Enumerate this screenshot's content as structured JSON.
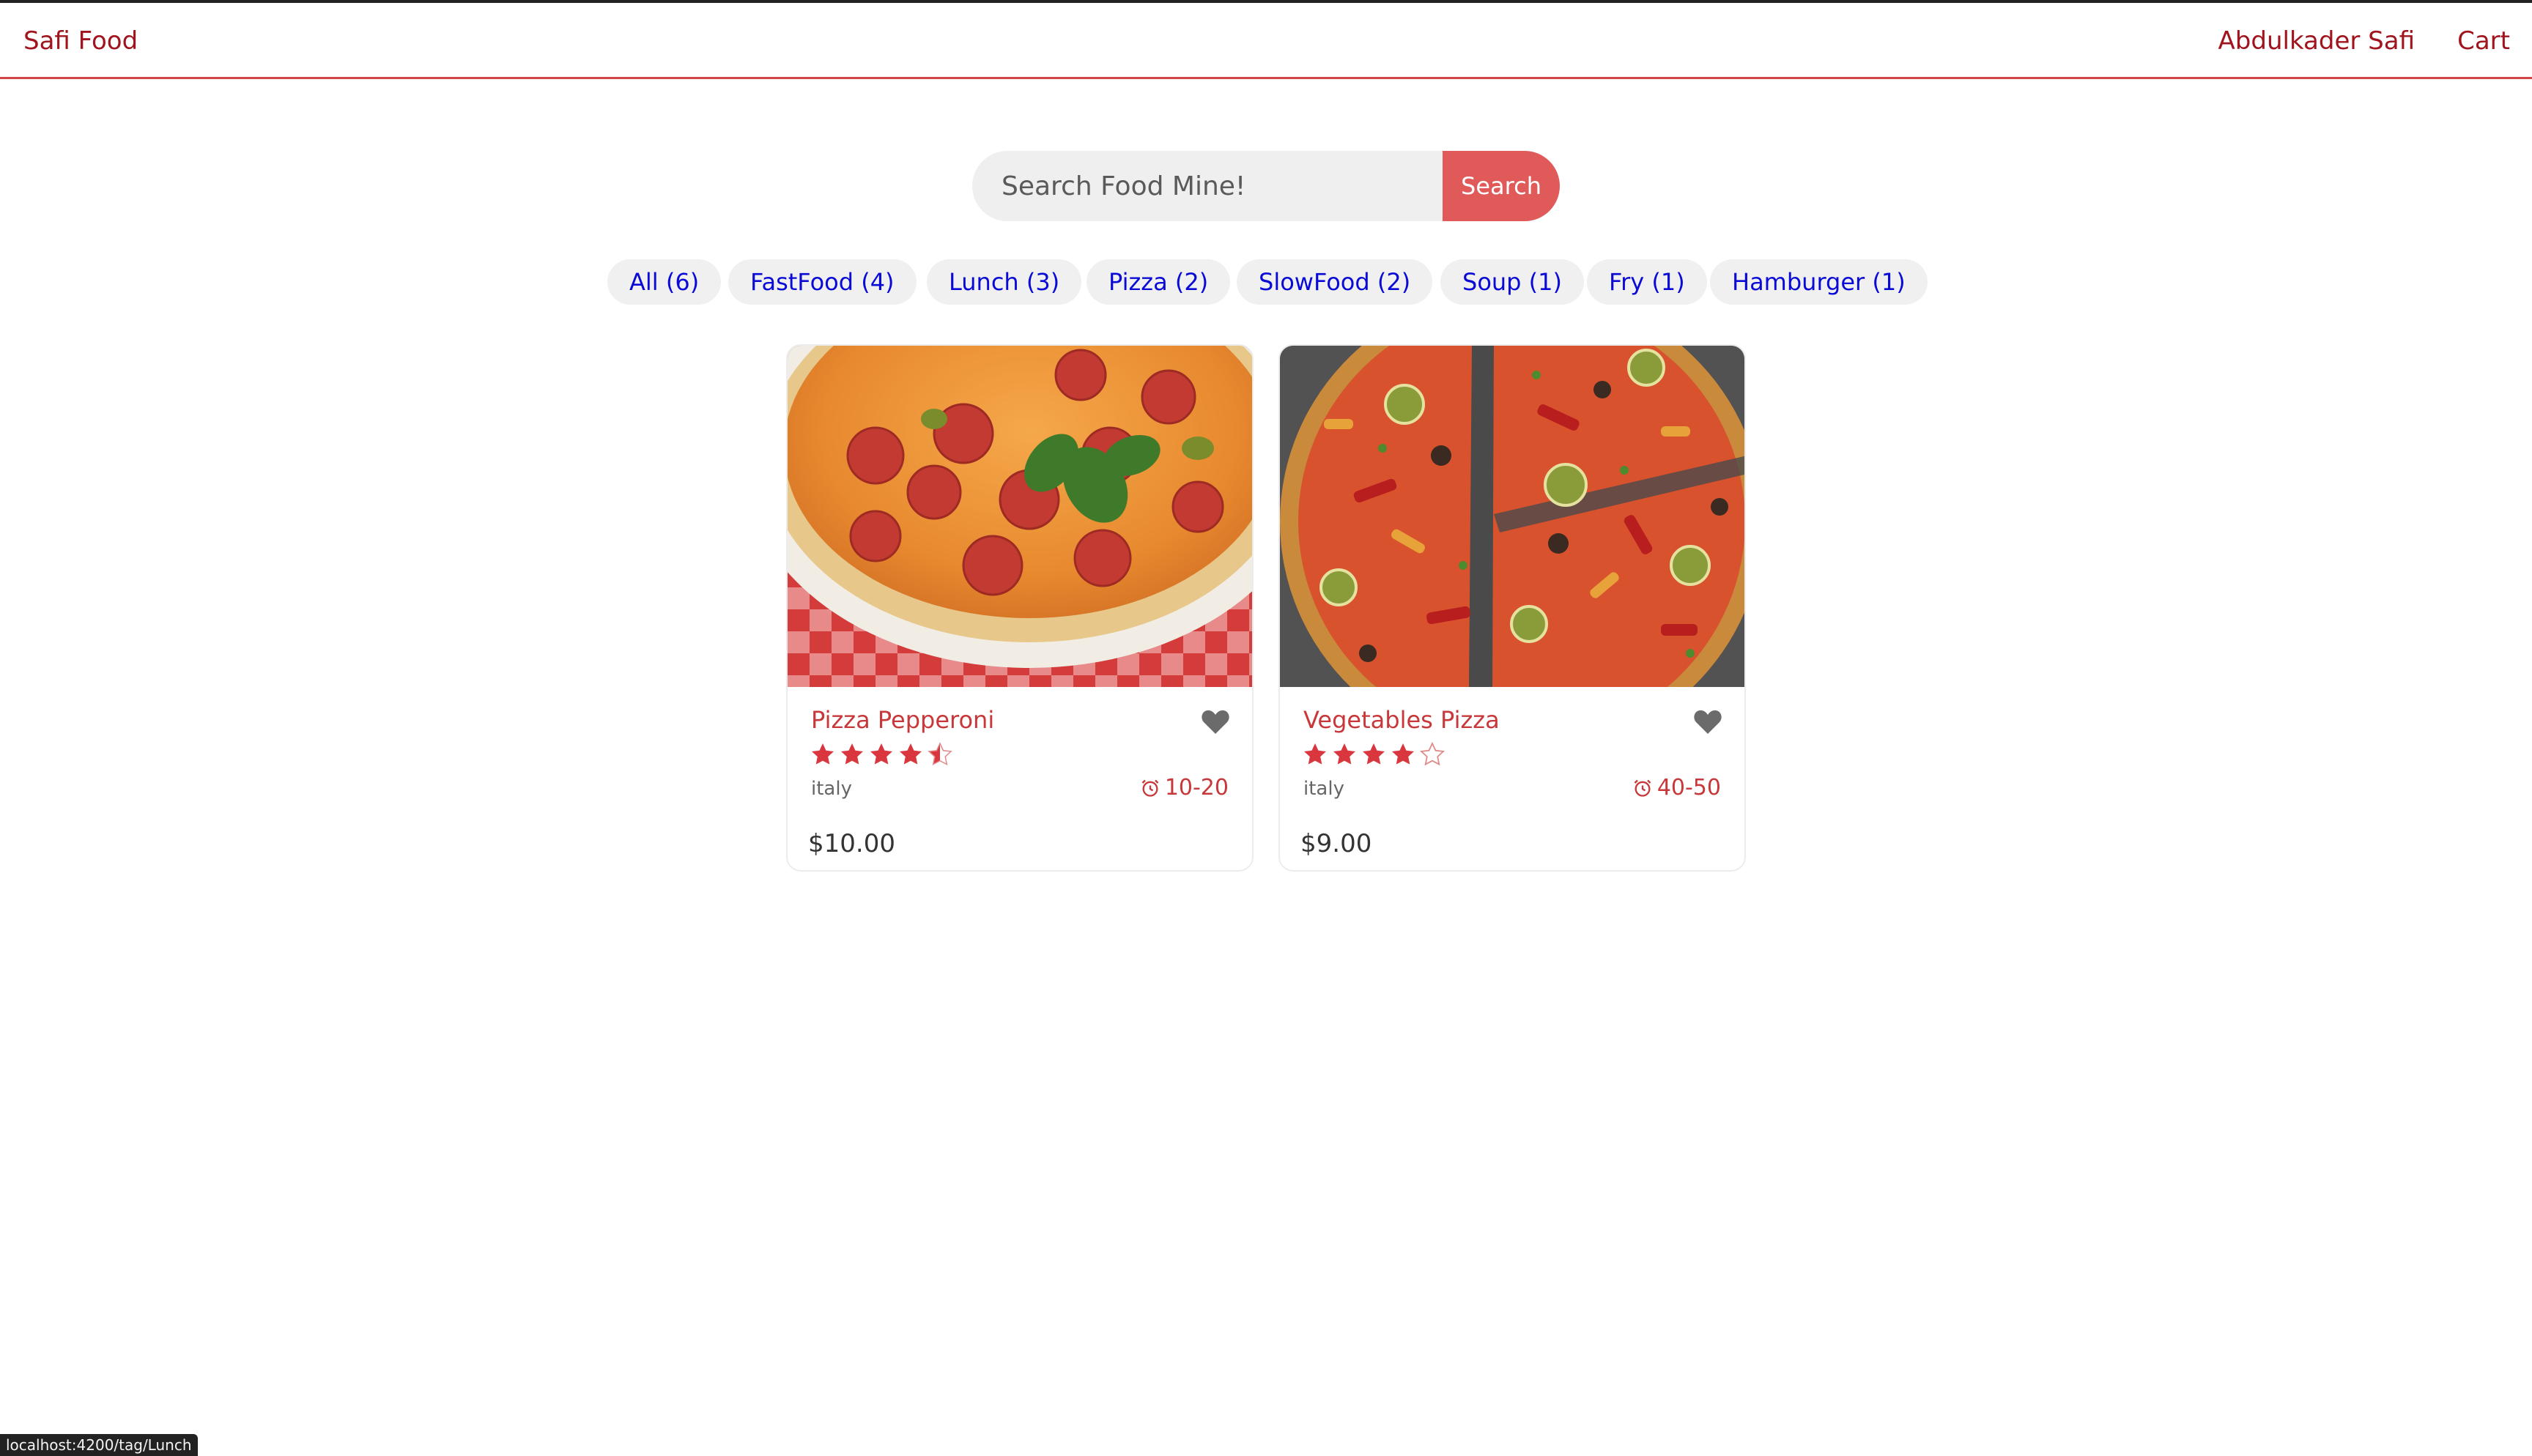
{
  "header": {
    "brand": "Safi Food",
    "user_name": "Abdulkader Safi",
    "cart_label": "Cart"
  },
  "search": {
    "placeholder": "Search Food Mine!",
    "button_label": "Search"
  },
  "tags": [
    {
      "label": "All (6)"
    },
    {
      "label": "FastFood (4)"
    },
    {
      "label": "Lunch (3)"
    },
    {
      "label": "Pizza (2)"
    },
    {
      "label": "SlowFood (2)"
    },
    {
      "label": "Soup (1)"
    },
    {
      "label": "Fry (1)"
    },
    {
      "label": "Hamburger (1)"
    }
  ],
  "foods": [
    {
      "name": "Pizza Pepperoni",
      "stars": 4.5,
      "origin": "italy",
      "cook_time": "10-20",
      "price": "$10.00",
      "favorite": false,
      "image": "pepperoni-pizza"
    },
    {
      "name": "Vegetables Pizza",
      "stars": 4,
      "origin": "italy",
      "cook_time": "40-50",
      "price": "$9.00",
      "favorite": false,
      "image": "vegetable-pizza"
    }
  ],
  "status_bar": {
    "url": "localhost:4200/tag/Lunch"
  },
  "colors": {
    "brand_red": "#a0141e",
    "accent_red": "#c8383a",
    "search_button": "#e15a5a",
    "tag_text": "#0a0ad6",
    "tag_bg": "#f0f0f0"
  }
}
